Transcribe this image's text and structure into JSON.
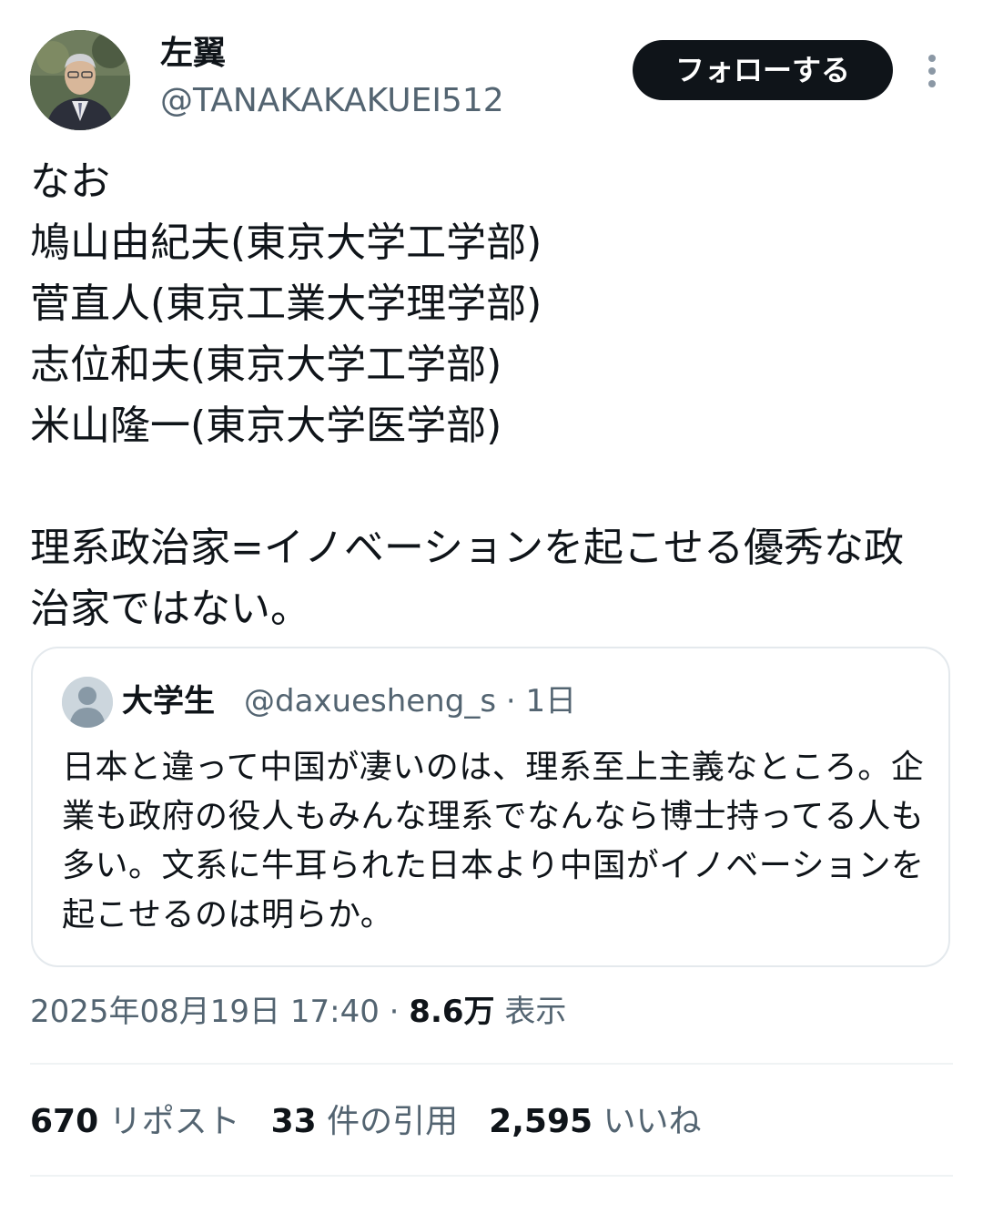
{
  "author": {
    "display_name": "左翼",
    "handle": "@TANAKAKAKUEI512"
  },
  "follow_label": "フォローする",
  "tweet_text": "なお\n鳩山由紀夫(東京大学工学部)\n菅直人(東京工業大学理学部)\n志位和夫(東京大学工学部)\n米山隆一(東京大学医学部)\n\n理系政治家=イノベーションを起こせる優秀な政治家ではない。",
  "quote": {
    "display_name": "大学生",
    "handle_time": "@daxuesheng_s · 1日",
    "text": "日本と違って中国が凄いのは、理系至上主義なところ。企業も政府の役人もみんな理系でなんなら博士持ってる人も多い。文系に牛耳られた日本より中国がイノベーションを起こせるのは明らか。"
  },
  "meta": {
    "timestamp": "2025年08月19日 17:40 · ",
    "views_count": "8.6万",
    "views_label": " 表示"
  },
  "stats": {
    "reposts_count": "670",
    "reposts_label": " リポスト",
    "quotes_count": "33",
    "quotes_label": " 件の引用",
    "likes_count": "2,595",
    "likes_label": " いいね"
  },
  "colors": {
    "text_primary": "#0f1419",
    "text_secondary": "#536471",
    "follow_button_bg": "#0f1419",
    "border": "#e4e9ed"
  },
  "icons": {
    "more": "more-dots-vertical-icon"
  }
}
